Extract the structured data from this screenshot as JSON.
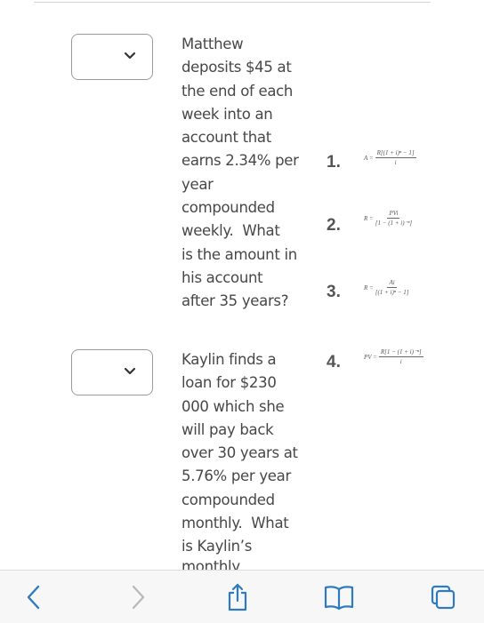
{
  "questions": [
    {
      "text": "Matthew deposits $45 at the end of each week into an account that earns 2.34% per year compounded weekly.  What is the amount in his account after 35 years?",
      "lines": [
        "Matthew",
        "deposits $45 at",
        "the end of each",
        "week into an",
        "account that",
        "earns 2.34% per",
        "year",
        "compounded",
        "weekly.  What",
        "is the amount in",
        "his account",
        "after 35 years?"
      ],
      "selected_value": ""
    },
    {
      "text": "Kaylin finds a loan for $230 000 which she will pay back over 30 years at 5.76% per year compounded monthly.  What is Kaylin's monthly",
      "lines": [
        "Kaylin finds a",
        "loan for $230",
        "000 which she",
        "will pay back",
        "over 30 years at",
        "5.76% per year",
        "compounded",
        "monthly.  What",
        "is Kaylin’s"
      ],
      "selected_value": ""
    }
  ],
  "clipped_line": "monthly",
  "options": [
    {
      "number": "1.",
      "lhs": "A =",
      "numerator": "R[(1 + i)ⁿ − 1]",
      "denominator": "i"
    },
    {
      "number": "2.",
      "lhs": "R =",
      "numerator": "PVi",
      "denominator": "[1 − (1 + i)⁻ⁿ]"
    },
    {
      "number": "3.",
      "lhs": "R =",
      "numerator": "Ai",
      "denominator": "[(1 + i)ⁿ − 1]"
    },
    {
      "number": "4.",
      "lhs": "PV =",
      "numerator": "R[1 − (1 + i)⁻ⁿ]",
      "denominator": "i"
    }
  ],
  "toolbar": {
    "back_icon": "chevron-left-icon",
    "forward_icon": "chevron-right-icon",
    "share_icon": "share-icon",
    "bookmarks_icon": "book-icon",
    "tabs_icon": "tabs-icon",
    "accent_color": "#2f7bbd",
    "disabled_color": "#b8b8b8"
  }
}
